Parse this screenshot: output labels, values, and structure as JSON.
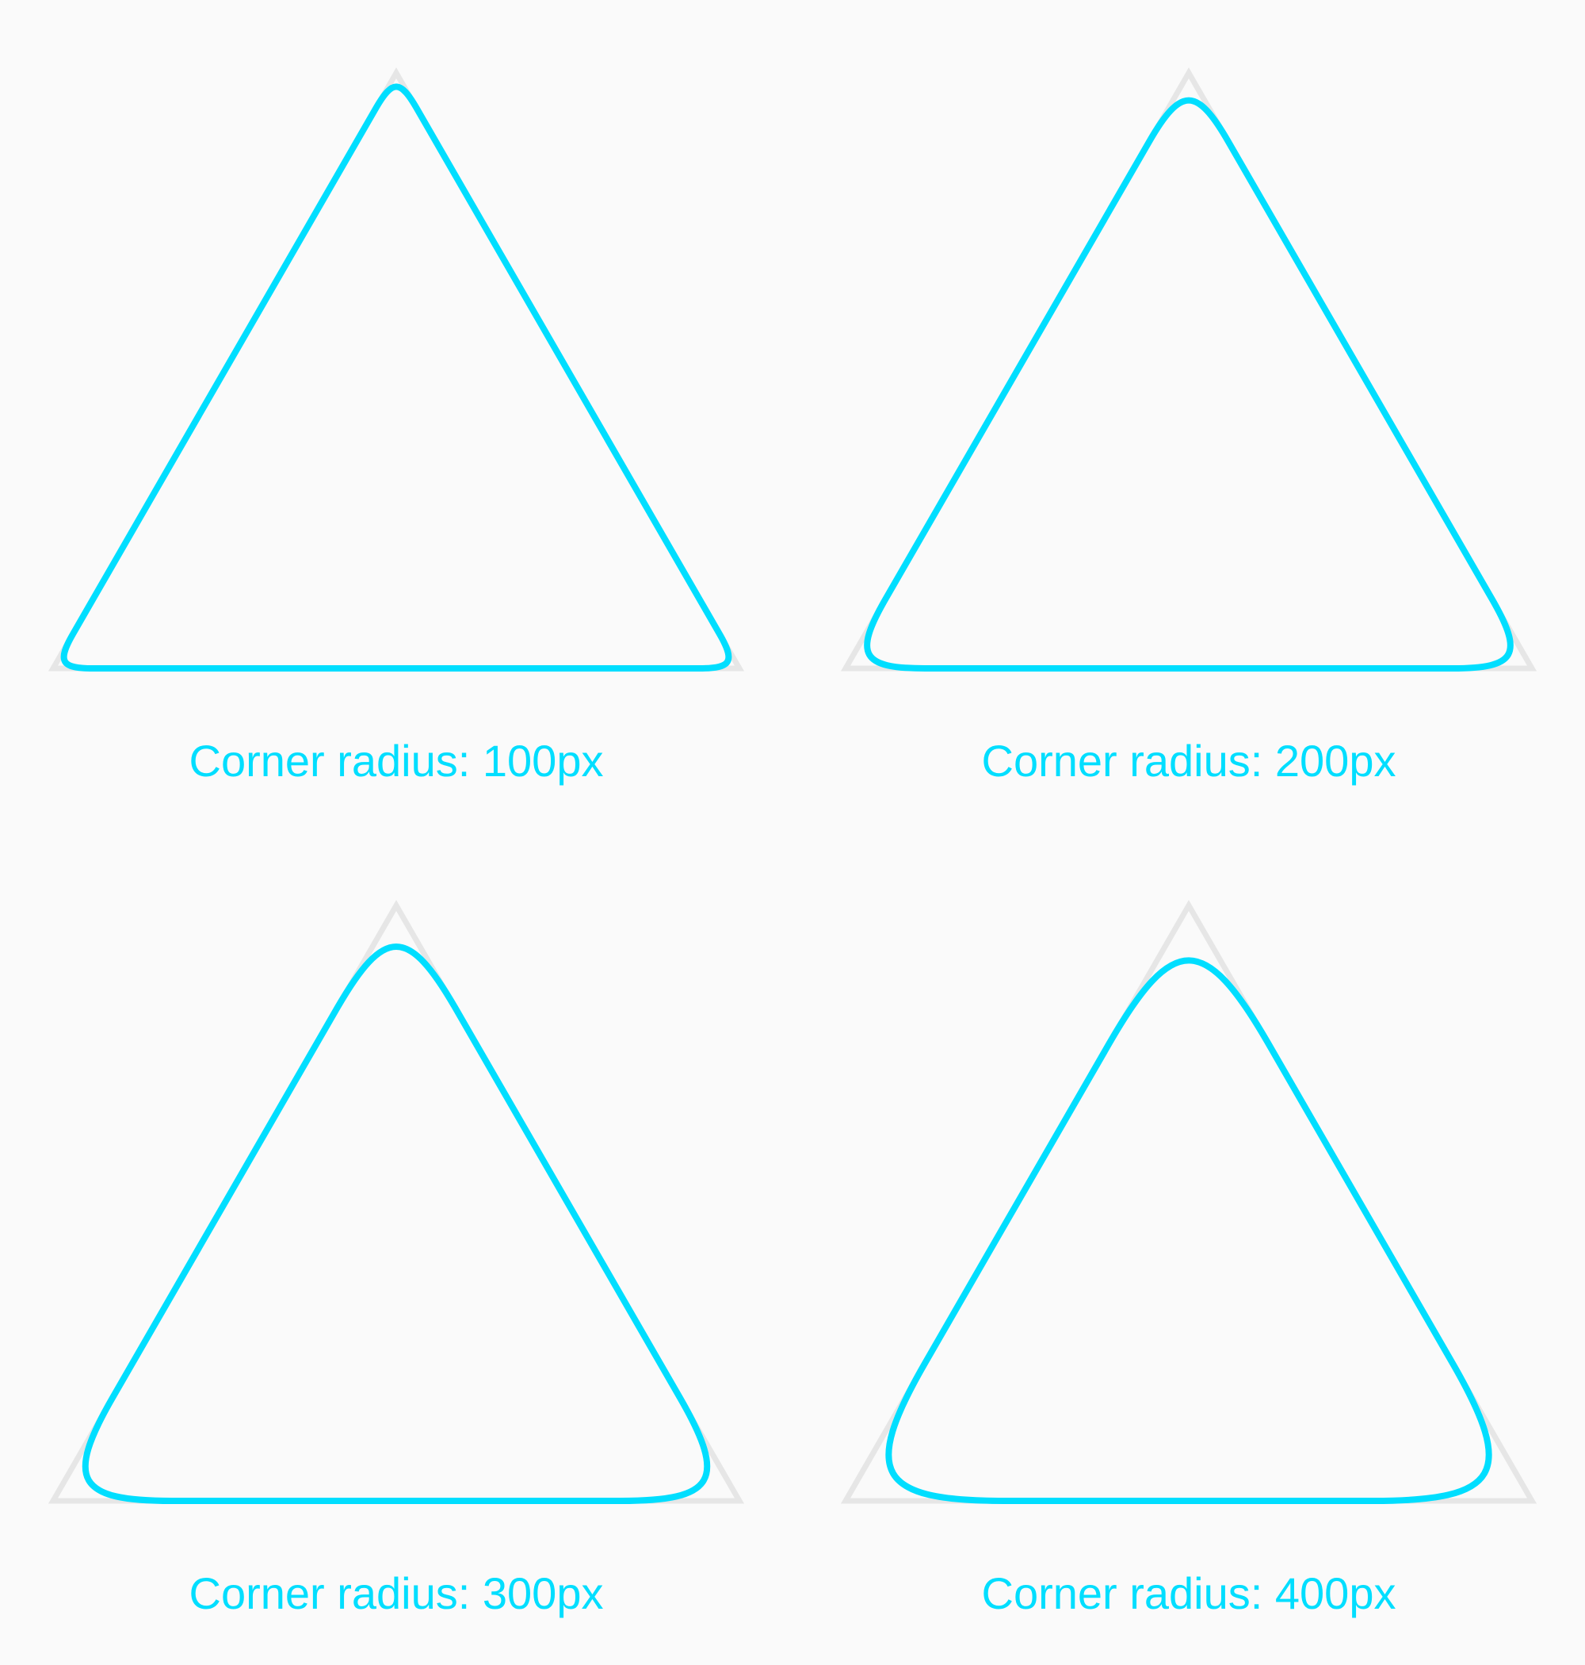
{
  "colors": {
    "background": "#fafafa",
    "accent": "#00deff",
    "reference": "#e6e6e6"
  },
  "panels": [
    {
      "label": "Corner radius: 100px",
      "corner_radius": 100
    },
    {
      "label": "Corner radius: 200px",
      "corner_radius": 200
    },
    {
      "label": "Corner radius: 300px",
      "corner_radius": 300
    },
    {
      "label": "Corner radius: 400px",
      "corner_radius": 400
    }
  ]
}
